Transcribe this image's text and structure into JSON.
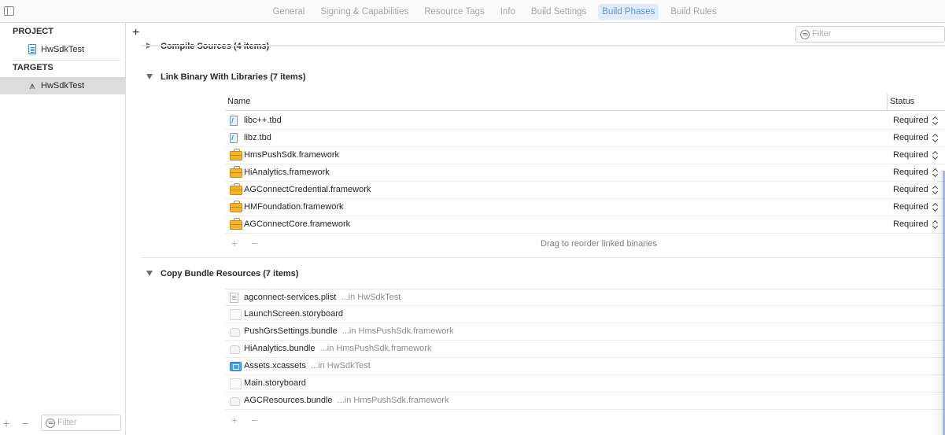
{
  "tabs": [
    "General",
    "Signing & Capabilities",
    "Resource Tags",
    "Info",
    "Build Settings",
    "Build Phases",
    "Build Rules"
  ],
  "active_tab": "Build Phases",
  "sidebar": {
    "project_header": "PROJECT",
    "project_item": "HwSdkTest",
    "targets_header": "TARGETS",
    "target_item": "HwSdkTest",
    "filter_placeholder": "Filter"
  },
  "main": {
    "filter_placeholder": "Filter",
    "compile_sources_title": "Compile Sources (4 items)",
    "link_binary": {
      "title": "Link Binary With Libraries (7 items)",
      "col_name": "Name",
      "col_status": "Status",
      "rows": [
        {
          "name": "libc++.tbd",
          "status": "Required",
          "icon": "tbd-icon"
        },
        {
          "name": "libz.tbd",
          "status": "Required",
          "icon": "tbd-icon"
        },
        {
          "name": "HmsPushSdk.framework",
          "status": "Required",
          "icon": "framework-icon"
        },
        {
          "name": "HiAnalytics.framework",
          "status": "Required",
          "icon": "framework-icon"
        },
        {
          "name": "AGConnectCredential.framework",
          "status": "Required",
          "icon": "framework-icon"
        },
        {
          "name": "HMFoundation.framework",
          "status": "Required",
          "icon": "framework-icon"
        },
        {
          "name": "AGConnectCore.framework",
          "status": "Required",
          "icon": "framework-icon"
        }
      ],
      "footer_hint": "Drag to reorder linked binaries"
    },
    "copy_bundle": {
      "title": "Copy Bundle Resources (7 items)",
      "rows": [
        {
          "name": "agconnect-services.plist",
          "location": "...in HwSdkTest",
          "icon": "plist-icon"
        },
        {
          "name": "LaunchScreen.storyboard",
          "location": "",
          "icon": "storyboard-icon"
        },
        {
          "name": "PushGrsSettings.bundle",
          "location": "...in HmsPushSdk.framework",
          "icon": "bundle-icon"
        },
        {
          "name": "HiAnalytics.bundle",
          "location": "...in HmsPushSdk.framework",
          "icon": "bundle-icon"
        },
        {
          "name": "Assets.xcassets",
          "location": "...in HwSdkTest",
          "icon": "assets-icon"
        },
        {
          "name": "Main.storyboard",
          "location": "",
          "icon": "storyboard-icon"
        },
        {
          "name": "AGCResources.bundle",
          "location": "...in HmsPushSdk.framework",
          "icon": "bundle-icon"
        }
      ]
    }
  }
}
